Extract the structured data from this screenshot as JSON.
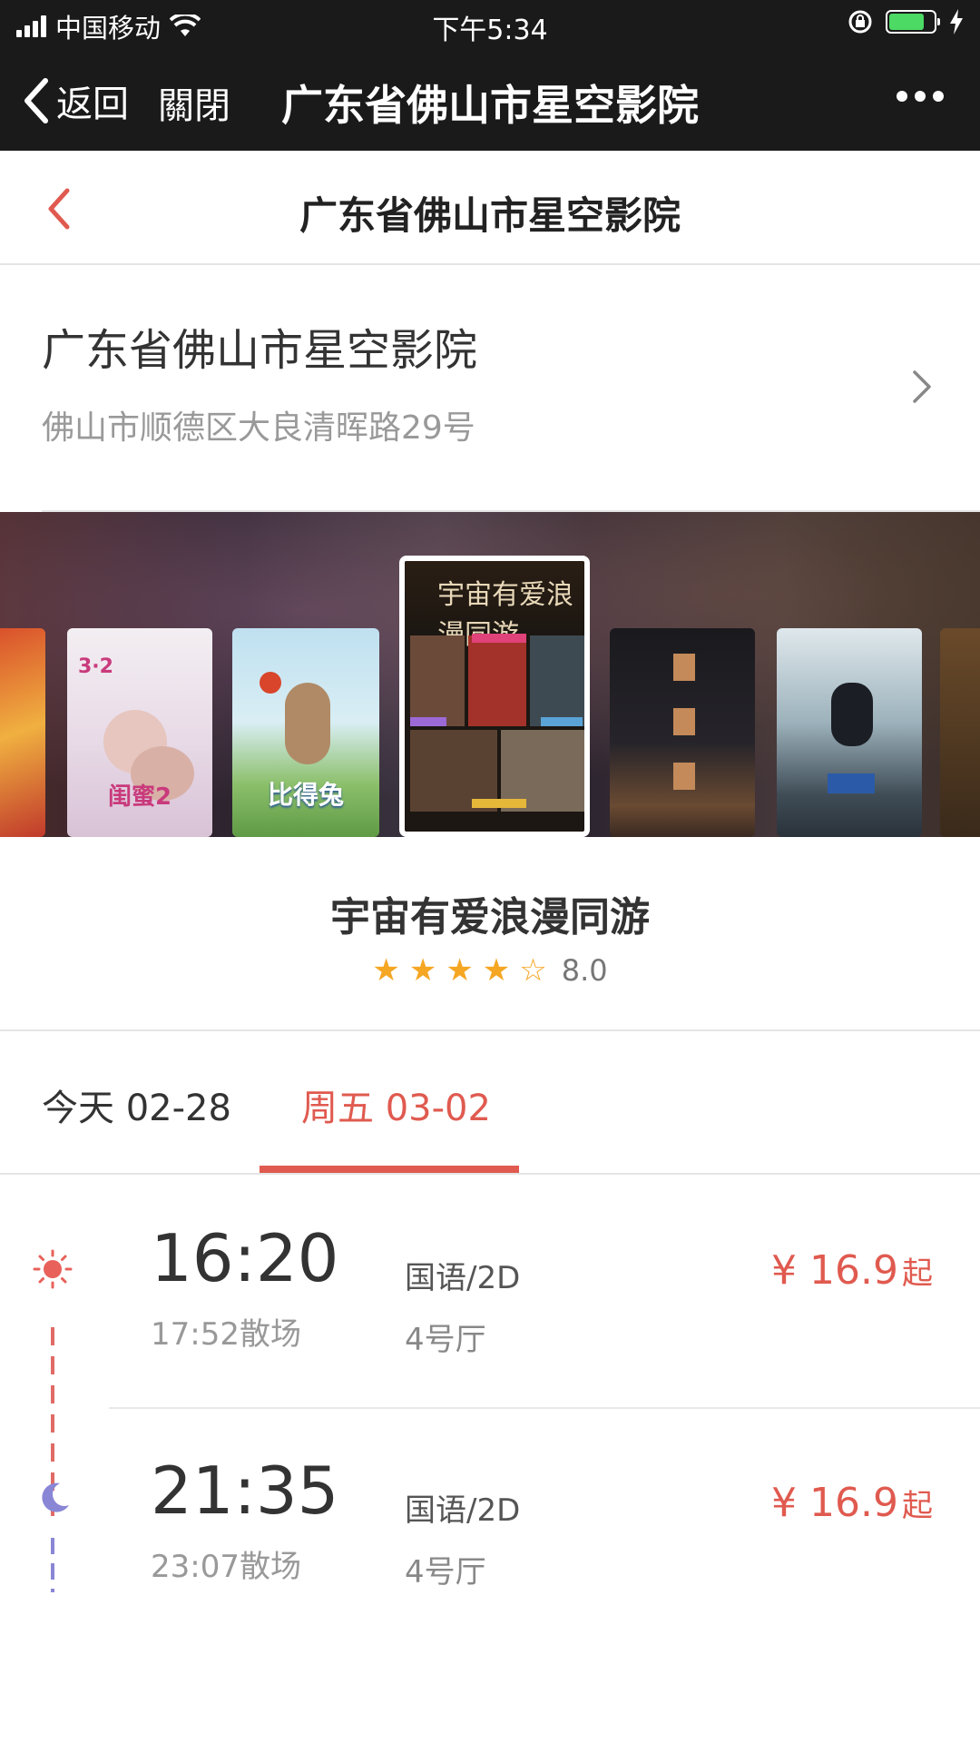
{
  "status_bar": {
    "carrier": "中国移动",
    "time": "下午5:34",
    "battery_color": "#4cd964"
  },
  "wechat_nav": {
    "back_label": "返回",
    "close_label": "關閉",
    "title": "广东省佛山市星空影院",
    "more_icon": "more-dots-icon"
  },
  "page_header": {
    "title": "广东省佛山市星空影院",
    "back_icon": "chevron-left-icon",
    "accent_color": "#e05a4f"
  },
  "cinema": {
    "name": "广东省佛山市星空影院",
    "address": "佛山市顺德区大良清晖路29号"
  },
  "posters": [
    {
      "caption": ""
    },
    {
      "caption": "闺蜜2"
    },
    {
      "caption": "比得兔"
    },
    {
      "caption": "宇宙有爱浪漫同游"
    },
    {
      "caption": ""
    },
    {
      "caption": ""
    }
  ],
  "movie": {
    "title": "宇宙有爱浪漫同游",
    "stars_filled": 4,
    "stars_total": 5,
    "score": "8.0"
  },
  "date_tabs": [
    {
      "label": "今天 02-28",
      "selected": false
    },
    {
      "label": "周五 03-02",
      "selected": true
    }
  ],
  "showtimes": [
    {
      "start": "16:20",
      "end": "17:52散场",
      "language": "国语/2D",
      "hall": "4号厅",
      "price": "¥ 16.9",
      "price_suffix": "起",
      "icon": "sun-icon"
    },
    {
      "start": "21:35",
      "end": "23:07散场",
      "language": "国语/2D",
      "hall": "4号厅",
      "price": "¥ 16.9",
      "price_suffix": "起",
      "icon": "moon-icon"
    }
  ]
}
